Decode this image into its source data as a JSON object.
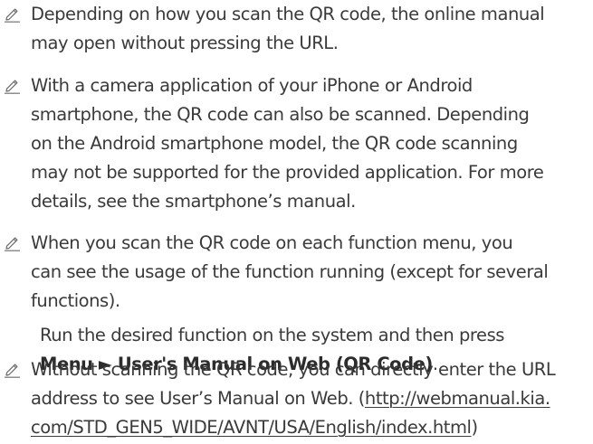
{
  "notes": [
    {
      "icon": "pencil-icon",
      "lines": [
        "Depending on how you scan the QR code, the online manual",
        "may open without pressing the URL."
      ]
    },
    {
      "icon": "pencil-icon",
      "lines": [
        "With a camera application of your iPhone or Android",
        "smartphone, the QR code can also be scanned. Depending",
        "on the Android smartphone model, the QR code scanning",
        "may not be supported for the provided application. For more",
        "details, see the smartphone’s manual."
      ]
    },
    {
      "icon": "pencil-icon",
      "lines": [
        "When you scan the QR code on each function menu, you",
        "can see the usage of the function running (except for several",
        "functions)."
      ],
      "sub": {
        "line1": "Run the desired function on the system and then press",
        "menu_path": "Menu ► User's Manual on Web (QR Code)",
        "period": "."
      }
    },
    {
      "icon": "pencil-icon",
      "line1": "Without scanning the QR code, you can directly enter the URL",
      "line2_prefix": "address to see User’s Manual on Web. (",
      "url_part1": "http://webmanual.kia.",
      "url_part2": "com/STD_GEN5_WIDE/AVNT/USA/English/index.html",
      "line3_suffix": ")"
    }
  ]
}
